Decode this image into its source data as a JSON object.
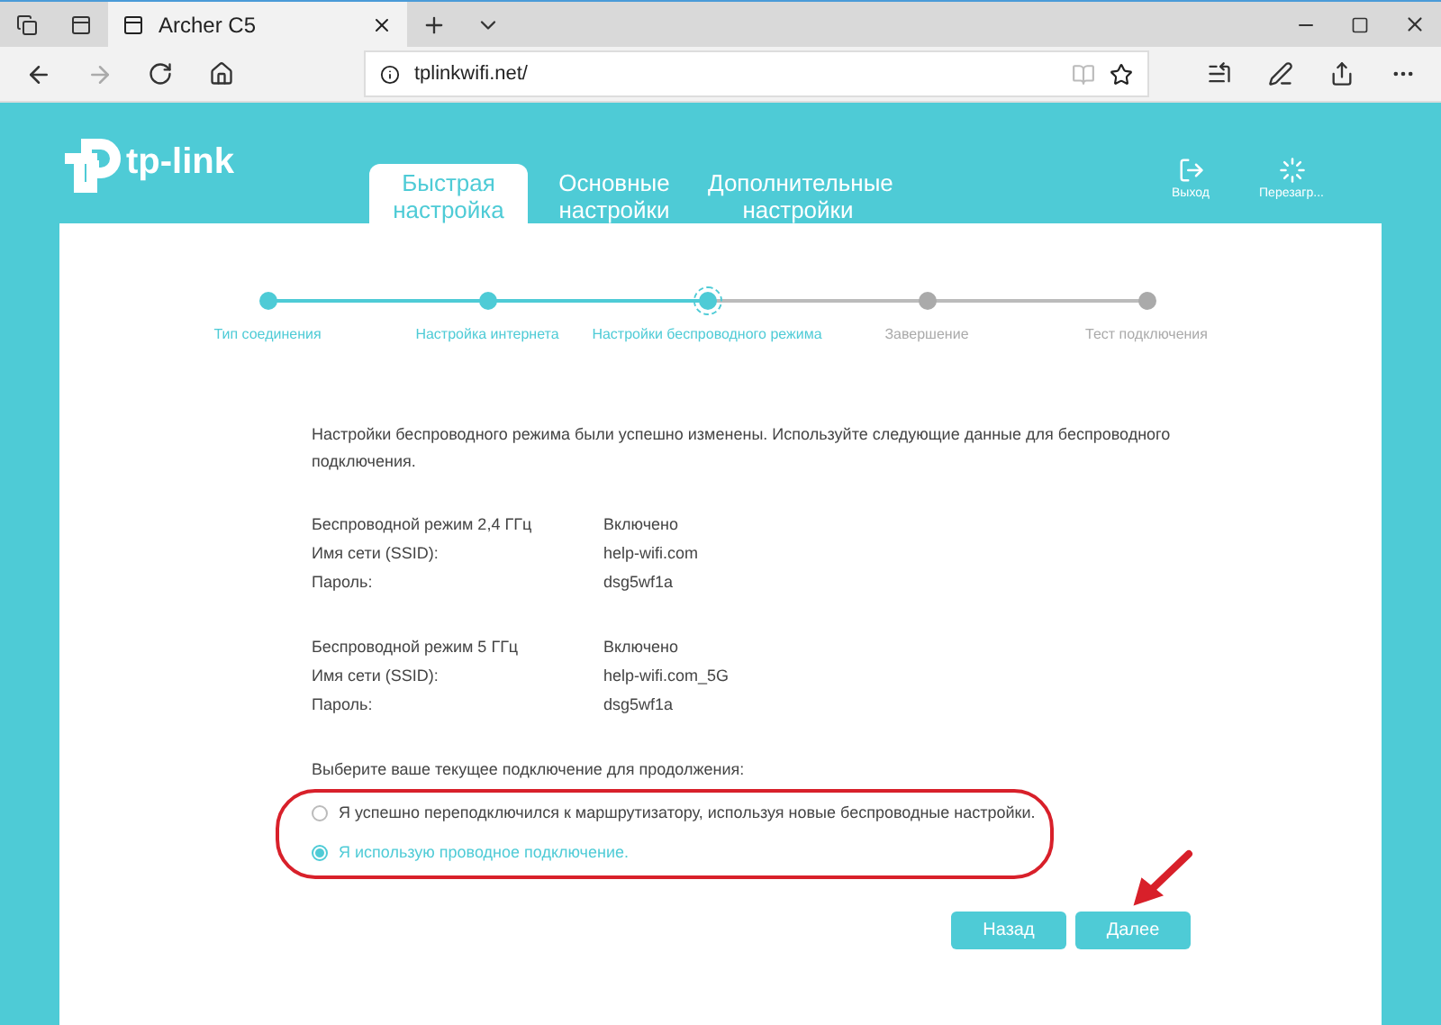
{
  "browser": {
    "tab_title": "Archer C5",
    "url": "tplinkwifi.net/"
  },
  "header": {
    "logo": "tp-link",
    "nav": [
      {
        "label": "Быстрая настройка",
        "selected": true
      },
      {
        "label": "Основные настройки",
        "selected": false
      },
      {
        "label": "Дополнительные настройки",
        "selected": false
      }
    ],
    "actions": [
      {
        "kind": "logout",
        "label": "Выход"
      },
      {
        "kind": "reboot",
        "label": "Перезагр..."
      }
    ]
  },
  "steps": [
    {
      "label": "Тип соединения",
      "current": false
    },
    {
      "label": "Настройка интернета",
      "current": false
    },
    {
      "label": "Настройки беспроводного режима",
      "current": true
    },
    {
      "label": "Завершение",
      "current": false
    },
    {
      "label": "Тест подключения",
      "current": false
    }
  ],
  "message": "Настройки беспроводного режима были успешно изменены. Используйте следующие данные для беспроводного подключения.",
  "groups": [
    {
      "rows": [
        {
          "label": "Беспроводной режим 2,4 ГГц",
          "value": "Включено"
        },
        {
          "label": "Имя сети (SSID):",
          "value": "help-wifi.com"
        },
        {
          "label": "Пароль:",
          "value": "dsg5wf1a"
        }
      ]
    },
    {
      "rows": [
        {
          "label": "Беспроводной режим 5 ГГц",
          "value": "Включено"
        },
        {
          "label": "Имя сети (SSID):",
          "value": "help-wifi.com_5G"
        },
        {
          "label": "Пароль:",
          "value": "dsg5wf1a"
        }
      ]
    }
  ],
  "prompt": "Выберите ваше текущее подключение для продолжения:",
  "options": [
    {
      "label": "Я успешно переподключился к маршрутизатору, используя новые беспроводные настройки.",
      "selected": false
    },
    {
      "label": "Я использую проводное подключение.",
      "selected": true
    }
  ],
  "buttons": [
    "Назад",
    "Далее"
  ]
}
